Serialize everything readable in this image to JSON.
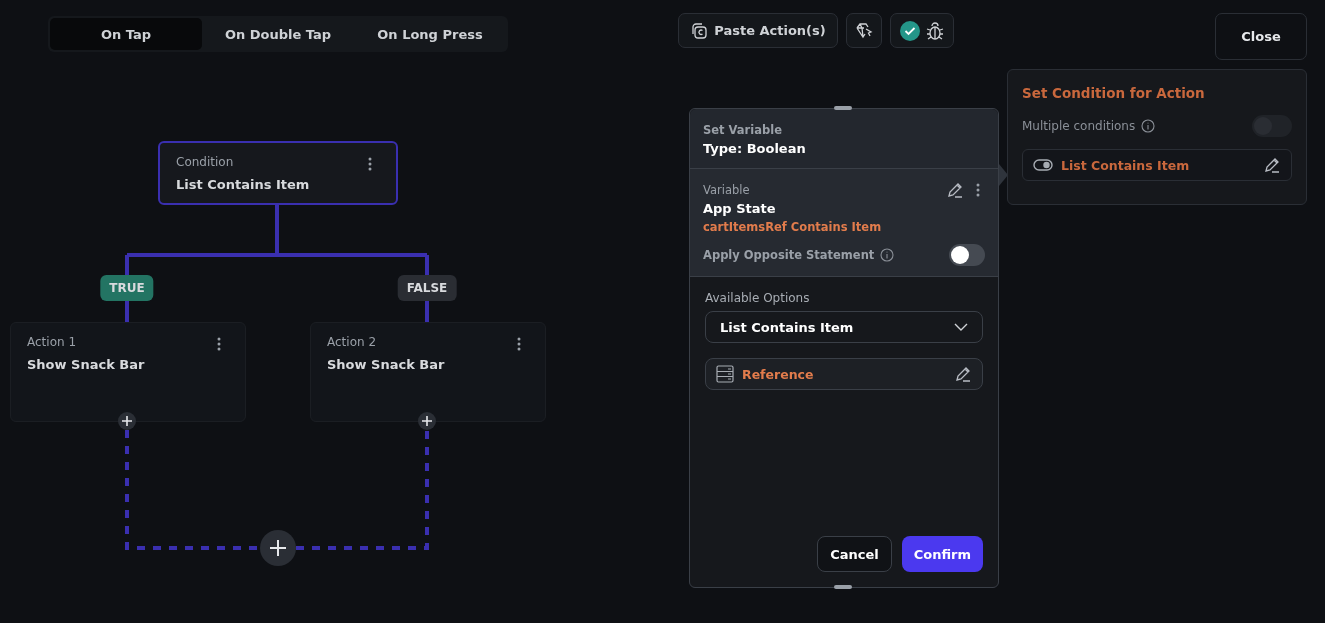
{
  "tabs": [
    {
      "label": "On Tap",
      "selected": true
    },
    {
      "label": "On Double Tap",
      "selected": false
    },
    {
      "label": "On Long Press",
      "selected": false
    }
  ],
  "toolbar": {
    "paste_button": "Paste Action(s)",
    "close_button": "Close"
  },
  "diagram": {
    "condition_node": {
      "label": "Condition",
      "title": "List Contains Item"
    },
    "branches": [
      {
        "kind": "true",
        "badge": "TRUE",
        "action": {
          "label": "Action 1",
          "title": "Show Snack Bar"
        }
      },
      {
        "kind": "false",
        "badge": "FALSE",
        "action": {
          "label": "Action 2",
          "title": "Show Snack Bar"
        }
      }
    ]
  },
  "variable_panel": {
    "header_label": "Set Variable",
    "header_title": "Type: Boolean",
    "variable_label": "Variable",
    "variable_title": "App State",
    "variable_detail": "cartItemsRef Contains Item",
    "opposite_label": "Apply Opposite Statement",
    "opposite_on": false,
    "options_label": "Available Options",
    "options_value": "List Contains Item",
    "reference_label": "Reference",
    "cancel_button": "Cancel",
    "confirm_button": "Confirm"
  },
  "condition_panel": {
    "title": "Set Condition for Action",
    "multiple_label": "Multiple conditions",
    "multiple_on": false,
    "condition_label": "List Contains Item"
  }
}
